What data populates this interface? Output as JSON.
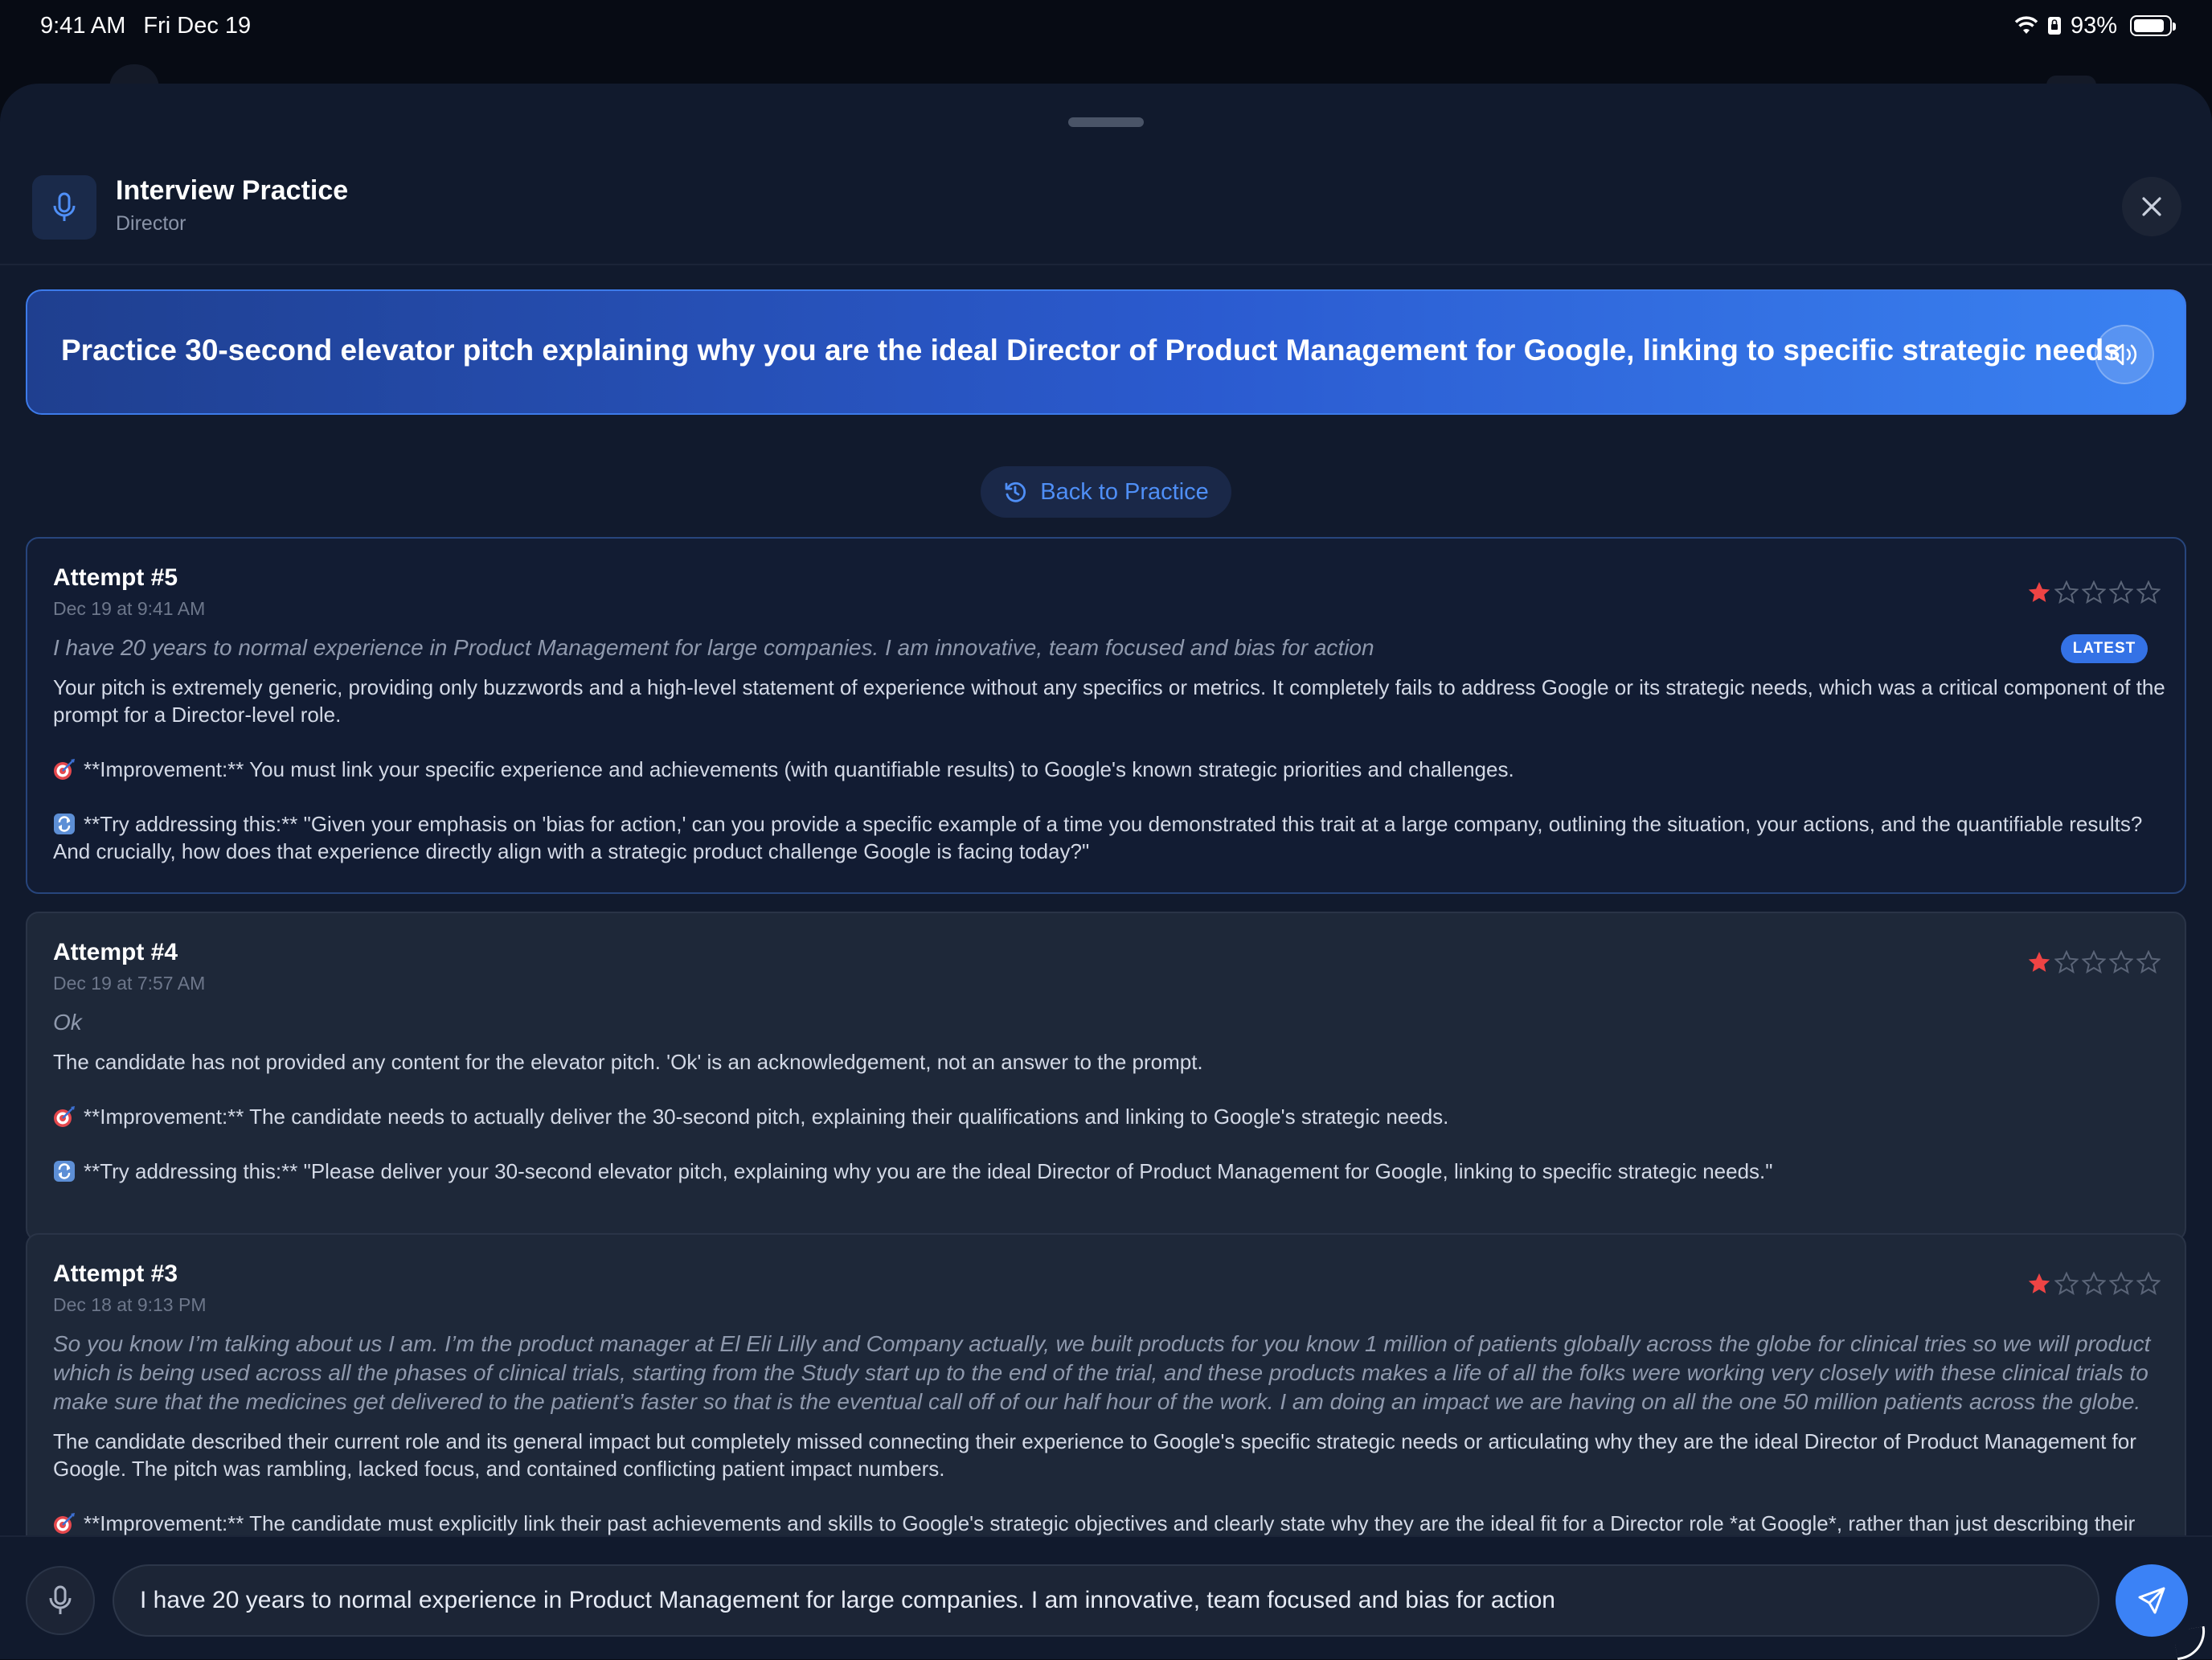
{
  "status": {
    "time": "9:41 AM",
    "date": "Fri Dec 19",
    "battery": "93%"
  },
  "header": {
    "title": "Interview Practice",
    "subtitle": "Director"
  },
  "prompt": {
    "text": "Practice 30-second elevator pitch explaining why you are the ideal Director of Product Management for Google, linking to specific strategic needs"
  },
  "back_button": {
    "label": "Back to Practice"
  },
  "badge": "LATEST",
  "colors": {
    "accent": "#3b82f6",
    "star_filled": "#ef4444",
    "star_empty": "#5b6578"
  },
  "attempts": [
    {
      "title": "Attempt #5",
      "date": "Dec 19 at 9:41 AM",
      "rating": 1,
      "max_rating": 5,
      "answer": "I have 20 years to normal experience in Product Management for large companies. I am innovative, team focused and bias for action",
      "feedback": "Your pitch is extremely generic, providing only buzzwords and a high-level statement of experience without any specifics or metrics. It completely fails to address Google or its strategic needs, which was a critical component of the prompt for a Director-level role.",
      "improvement": "**Improvement:** You must link your specific experience and achievements (with quantifiable results) to Google's known strategic priorities and challenges.",
      "try": "**Try addressing this:** \"Given your emphasis on 'bias for action,' can you provide a specific example of a time you demonstrated this trait at a large company, outlining the situation, your actions, and the quantifiable results? And crucially, how does that experience directly align with a strategic product challenge Google is facing today?\""
    },
    {
      "title": "Attempt #4",
      "date": "Dec 19 at 7:57 AM",
      "rating": 1,
      "max_rating": 5,
      "answer": "Ok",
      "feedback": "The candidate has not provided any content for the elevator pitch. 'Ok' is an acknowledgement, not an answer to the prompt.",
      "improvement": "**Improvement:** The candidate needs to actually deliver the 30-second pitch, explaining their qualifications and linking to Google's strategic needs.",
      "try": "**Try addressing this:** \"Please deliver your 30-second elevator pitch, explaining why you are the ideal Director of Product Management for Google, linking to specific strategic needs.\""
    },
    {
      "title": "Attempt #3",
      "date": "Dec 18 at 9:13 PM",
      "rating": 1,
      "max_rating": 5,
      "answer": "So you know I’m talking about us I am. I’m the product manager at El Eli Lilly and Company actually, we built products for you know 1 million of patients globally across the globe for clinical tries so we will product which is being used across all the phases of clinical trials, starting from the Study start up to the end of the trial, and these products makes a life of all the folks were working very closely with these clinical trials to make sure that the medicines get delivered to the patient’s faster so that is the eventual call off of our half hour of the work. I am doing an impact we are having on all the one 50 million patients across the globe.",
      "feedback": "The candidate described their current role and its general impact but completely missed connecting their experience to Google's specific strategic needs or articulating why they are the ideal Director of Product Management for Google. The pitch was rambling, lacked focus, and contained conflicting patient impact numbers.",
      "improvement": "**Improvement:** The candidate must explicitly link their past achievements and skills to Google's strategic objectives and clearly state why they are the ideal fit for a Director role *at Google*, rather than just describing their"
    }
  ],
  "input": {
    "value": "I have 20 years to normal experience in Product Management for large companies. I am innovative, team focused and bias for action"
  },
  "icons": {
    "wifi": "wifi-icon",
    "battery": "battery-icon",
    "mic": "microphone-icon",
    "close": "close-icon",
    "speaker": "speaker-icon",
    "history": "history-icon",
    "target": "target-icon",
    "repeat": "repeat-icon",
    "send": "send-icon",
    "star": "star-icon"
  }
}
